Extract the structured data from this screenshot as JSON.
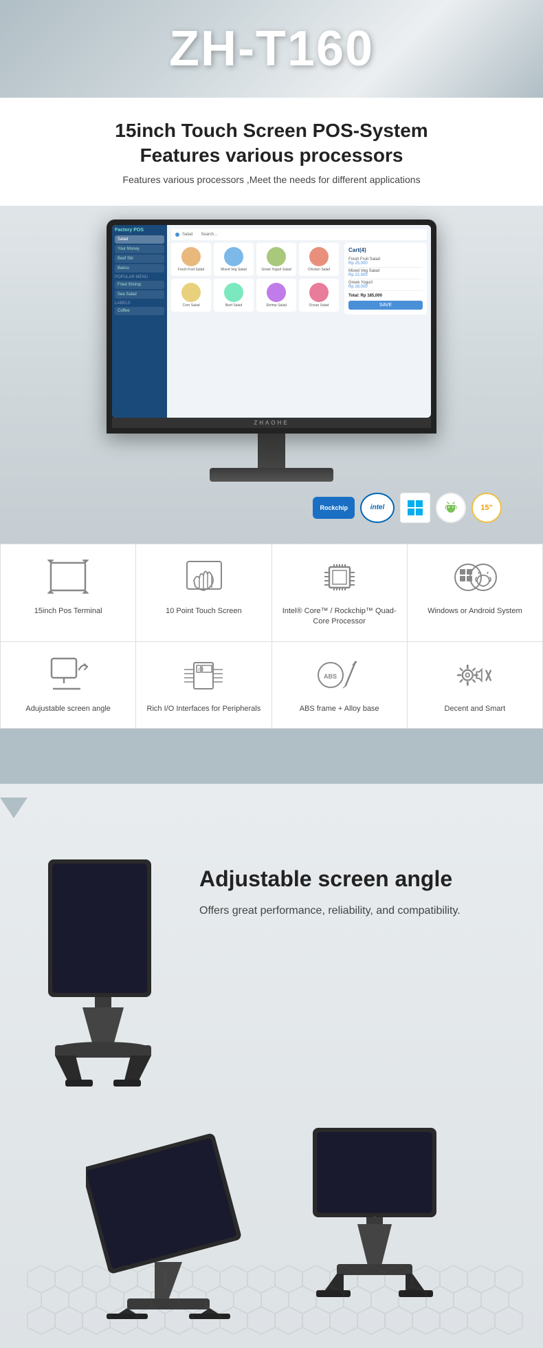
{
  "hero": {
    "title": "ZH-T160"
  },
  "features_section": {
    "title": "15inch Touch Screen POS-System\nFeatures various processors",
    "subtitle": "Features various processors ,Meet the needs for different applications"
  },
  "brand_badges": [
    {
      "id": "rockchip",
      "label": "Rockchip",
      "type": "rockchip"
    },
    {
      "id": "intel",
      "label": "intel",
      "type": "intel"
    },
    {
      "id": "windows",
      "label": "Windows",
      "type": "windows"
    },
    {
      "id": "android",
      "label": "Android",
      "type": "android"
    },
    {
      "id": "15inch",
      "label": "15\"",
      "type": "15inch"
    }
  ],
  "feature_cells": [
    {
      "id": "15inch-pos",
      "label": "15inch Pos Terminal",
      "icon": "expand-icon"
    },
    {
      "id": "touch-screen",
      "label": "10 Point Touch Screen",
      "icon": "touch-icon"
    },
    {
      "id": "processor",
      "label": "Intel® Core™ / Rockchip™ Quad-Core Processor",
      "icon": "cpu-icon"
    },
    {
      "id": "os",
      "label": "Windows or Android System",
      "icon": "os-icon"
    },
    {
      "id": "screen-angle",
      "label": "Adujustable screen angle",
      "icon": "angle-icon"
    },
    {
      "id": "io",
      "label": "Rich I/O Interfaces for Peripherals",
      "icon": "io-icon"
    },
    {
      "id": "abs",
      "label": "ABS frame + Alloy base",
      "icon": "abs-icon"
    },
    {
      "id": "design",
      "label": "Decent and Smart",
      "icon": "design-icon"
    }
  ],
  "adjustable": {
    "heading": "Adjustable screen angle",
    "description": "Offers great performance, reliability, and compatibility."
  },
  "pos_screen": {
    "brand": "ZHAOHE",
    "cart_title": "Cart(4)",
    "pay_button": "SAVE"
  },
  "food_items": [
    {
      "color": "#e8a87c"
    },
    {
      "color": "#7cb8e8"
    },
    {
      "color": "#a8e87c"
    },
    {
      "color": "#e87ca8"
    },
    {
      "color": "#e8d07c"
    },
    {
      "color": "#7ce8d0"
    },
    {
      "color": "#d07ce8"
    },
    {
      "color": "#e87c7c"
    }
  ]
}
